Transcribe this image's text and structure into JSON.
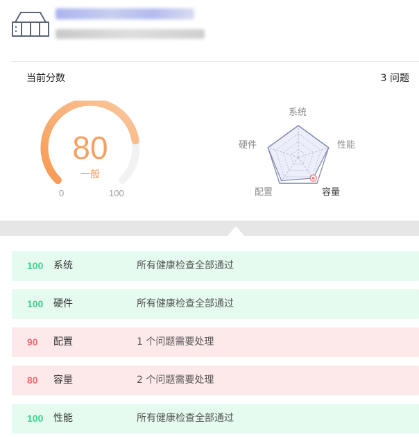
{
  "device": {
    "icon": "server-storage-icon"
  },
  "summary": {
    "score_title": "当前分数",
    "issues_text": "3 问题"
  },
  "gauge": {
    "score": "80",
    "level": "一般",
    "min": "0",
    "max": "100",
    "value_fraction": 0.8,
    "color_start": "#f79a52",
    "color_end": "#fbc8a0",
    "track": "#f2f2f2"
  },
  "radar": {
    "axes": [
      {
        "label": "系统",
        "value": 100
      },
      {
        "label": "性能",
        "value": 100
      },
      {
        "label": "容量",
        "value": 80
      },
      {
        "label": "配置",
        "value": 90
      },
      {
        "label": "硬件",
        "value": 100
      }
    ],
    "max": 100,
    "highlight_axis": "容量"
  },
  "results": [
    {
      "score": "100",
      "name": "系统",
      "message": "所有健康检查全部通过",
      "status": "ok"
    },
    {
      "score": "100",
      "name": "硬件",
      "message": "所有健康检查全部通过",
      "status": "ok"
    },
    {
      "score": "90",
      "name": "配置",
      "message": "1 个问题需要处理",
      "status": "bad"
    },
    {
      "score": "80",
      "name": "容量",
      "message": "2 个问题需要处理",
      "status": "bad"
    },
    {
      "score": "100",
      "name": "性能",
      "message": "所有健康检查全部通过",
      "status": "ok"
    }
  ]
}
